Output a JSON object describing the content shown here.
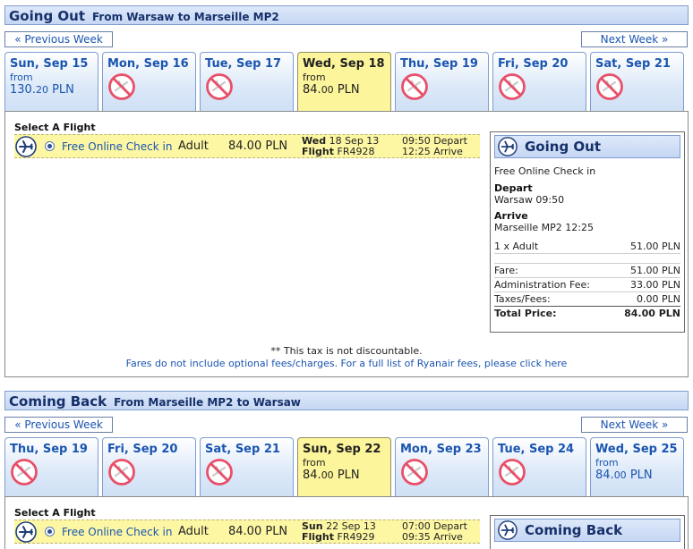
{
  "going_out": {
    "title": "Going Out",
    "route": "From Warsaw to Marseille MP2",
    "prev_week": "« Previous Week",
    "next_week": "Next Week »",
    "days": [
      {
        "label": "Sun, Sep 15",
        "from": "from",
        "price_int": "130.",
        "price_dec": "20",
        "currency": " PLN",
        "available": true,
        "selected": false
      },
      {
        "label": "Mon, Sep 16",
        "available": false,
        "selected": false
      },
      {
        "label": "Tue, Sep 17",
        "available": false,
        "selected": false
      },
      {
        "label": "Wed, Sep 18",
        "from": "from",
        "price_int": "84.",
        "price_dec": "00",
        "currency": " PLN",
        "available": true,
        "selected": true
      },
      {
        "label": "Thu, Sep 19",
        "available": false,
        "selected": false
      },
      {
        "label": "Fri, Sep 20",
        "available": false,
        "selected": false
      },
      {
        "label": "Sat, Sep 21",
        "available": false,
        "selected": false
      }
    ],
    "select_title": "Select A Flight",
    "flight": {
      "checkin": "Free Online Check in",
      "passenger": "Adult",
      "price": "84.00 PLN",
      "day_name": "Wed",
      "date": "18 Sep 13",
      "flight_label": "Flight",
      "flight_no": "FR4928",
      "depart": "09:50 Depart",
      "arrive": "12:25 Arrive"
    },
    "summary": {
      "title": "Going Out",
      "checkin": "Free Online Check in",
      "depart_label": "Depart",
      "depart_value": "Warsaw 09:50",
      "arrive_label": "Arrive",
      "arrive_value": "Marseille MP2 12:25",
      "pax_label": "1 x Adult",
      "pax_value": "51.00 PLN",
      "fare_label": "Fare:",
      "fare_value": "51.00 PLN",
      "admin_label": "Administration Fee:",
      "admin_value": "33.00 PLN",
      "taxes_label": "Taxes/Fees:",
      "taxes_value": "0.00 PLN",
      "total_label": "Total Price:",
      "total_value": "84.00 PLN"
    },
    "note_tax": "** This tax is not discountable.",
    "note_fees": "Fares do not include optional fees/charges. For a full list of Ryanair fees, please click here"
  },
  "coming_back": {
    "title": "Coming Back",
    "route": "From Marseille MP2 to Warsaw",
    "prev_week": "« Previous Week",
    "next_week": "Next Week »",
    "days": [
      {
        "label": "Thu, Sep 19",
        "available": false,
        "selected": false
      },
      {
        "label": "Fri, Sep 20",
        "available": false,
        "selected": false
      },
      {
        "label": "Sat, Sep 21",
        "available": false,
        "selected": false
      },
      {
        "label": "Sun, Sep 22",
        "from": "from",
        "price_int": "84.",
        "price_dec": "00",
        "currency": " PLN",
        "available": true,
        "selected": true
      },
      {
        "label": "Mon, Sep 23",
        "available": false,
        "selected": false
      },
      {
        "label": "Tue, Sep 24",
        "available": false,
        "selected": false
      },
      {
        "label": "Wed, Sep 25",
        "from": "from",
        "price_int": "84.",
        "price_dec": "00",
        "currency": " PLN",
        "available": true,
        "selected": false
      }
    ],
    "select_title": "Select A Flight",
    "flight": {
      "checkin": "Free Online Check in",
      "passenger": "Adult",
      "price": "84.00 PLN",
      "day_name": "Sun",
      "date": "22 Sep 13",
      "flight_label": "Flight",
      "flight_no": "FR4929",
      "depart": "07:00 Depart",
      "arrive": "09:35 Arrive"
    },
    "summary": {
      "title": "Coming Back"
    }
  },
  "colors": {
    "link_blue": "#1a55b0",
    "selected_tab": "#fdf59b",
    "header_navy": "#16306a",
    "no_flight_red": "#e8506a"
  }
}
